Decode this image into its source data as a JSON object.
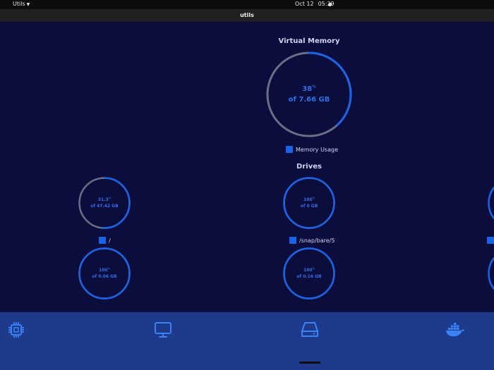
{
  "system_bar": {
    "app_menu": "Utils",
    "date": "Oct 12",
    "time": "05:29"
  },
  "window": {
    "title": "utils"
  },
  "virtual_memory": {
    "title": "Virtual Memory",
    "percent": "38",
    "percent_unit": "%",
    "percent_value": 38,
    "total_text": "of 7.66 GB",
    "legend": "Memory Usage"
  },
  "drives": {
    "title": "Drives",
    "items": [
      {
        "percent": "51.3",
        "percent_value": 51.3,
        "total_text": "of 47.42 GB",
        "label": "/"
      },
      {
        "percent": "100",
        "percent_value": 100,
        "total_text": "of 0 GB",
        "label": "/snap/bare/5"
      },
      {
        "percent": "100",
        "percent_value": 100,
        "total_text": "of 0.06 GB",
        "label": ""
      },
      {
        "percent": "100",
        "percent_value": 100,
        "total_text": "of 0.16 GB",
        "label": ""
      }
    ],
    "percent_unit": "%"
  },
  "nav": [
    {
      "name": "cpu-icon"
    },
    {
      "name": "monitor-icon"
    },
    {
      "name": "drive-icon"
    },
    {
      "name": "docker-icon"
    }
  ],
  "colors": {
    "background": "#0b0d3d",
    "accent": "#1a63e6",
    "track": "#6b6f86",
    "bottom_bar": "#1e3a8a"
  }
}
